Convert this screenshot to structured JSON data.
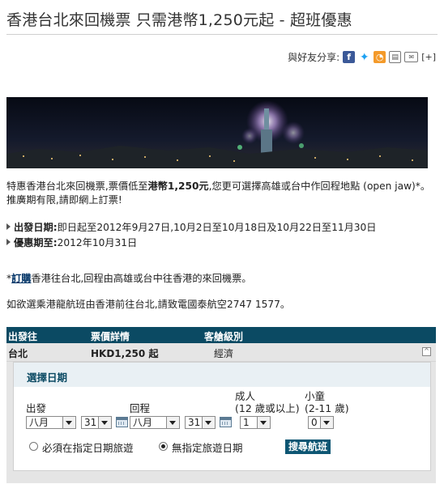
{
  "page": {
    "title": "香港台北來回機票 只需港幣1,250元起 - 超班優惠"
  },
  "share": {
    "label": "與好友分享:",
    "icons": [
      "facebook-icon",
      "twitter-icon",
      "rss-icon",
      "print-icon",
      "email-icon"
    ],
    "more": "[+]"
  },
  "intro": {
    "line1_a": "特惠香港台北來回機票,票價低至",
    "line1_price": "港幣1,250元",
    "line1_b": ",您更可選擇高雄或台中作回程地點 (open jaw)*。推廣期有限,請即網上訂票!"
  },
  "details": {
    "depart_label": "出發日期:",
    "depart_value": "即日起至2012年9月27日,10月2日至10月18日及10月22日至11月30日",
    "promo_label": "優惠期至:",
    "promo_value": "2012年10月31日"
  },
  "note": {
    "star": "*",
    "link": "訂購",
    "text": "香港往台北,回程由高雄或台中往香港的來回機票。"
  },
  "contact": {
    "text": "如欲選乘港龍航班由香港前往台北,請致電國泰航空2747 1577。"
  },
  "table": {
    "headers": [
      "出發往",
      "票價詳情",
      "客艙級別"
    ],
    "row": {
      "destination": "台北",
      "price": "HKD1,250 起",
      "cabin": "經濟"
    },
    "collapse_symbol": "^"
  },
  "booking": {
    "title": "選擇日期",
    "depart_label": "出發",
    "return_label": "回程",
    "adult_label": "成人",
    "adult_sub": "(12 歲或以上)",
    "child_label": "小童",
    "child_sub": "(2-11 歲)",
    "depart_month": "八月",
    "depart_day": "31",
    "return_month": "八月",
    "return_day": "31",
    "adults": "1",
    "children": "0",
    "radio_fixed": "必須在指定日期旅遊",
    "radio_flexible": "無指定旅遊日期",
    "selected_radio": "flexible",
    "search_button": "搜尋航班"
  }
}
